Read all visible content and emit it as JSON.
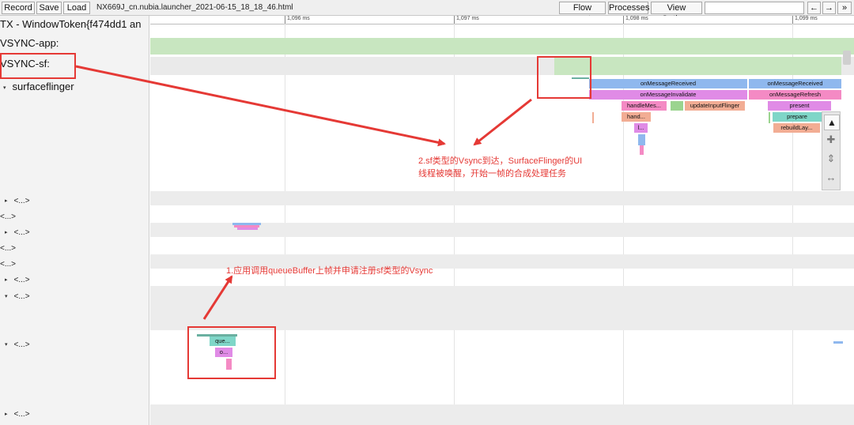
{
  "toolbar": {
    "record": "Record",
    "save": "Save",
    "load": "Load",
    "file_title": "NX669J_cn.nubia.launcher_2021-06-15_18_18_46.html",
    "flow_events": "Flow events",
    "processes": "Processes",
    "view_options": "View Options",
    "prev": "←",
    "next": "→",
    "more": "»"
  },
  "sidebar": {
    "tracks": [
      {
        "label": "TX - WindowToken{f474dd1 an"
      },
      {
        "label": "VSYNC-app:"
      },
      {
        "label": "VSYNC-sf:"
      },
      {
        "label": "surfaceflinger"
      }
    ],
    "collapsed": [
      {
        "label": "<...>",
        "arrow": "▸"
      },
      {
        "label": "<...>",
        "arrow": ""
      },
      {
        "label": "<...>",
        "arrow": "▸"
      },
      {
        "label": "<...>",
        "arrow": ""
      },
      {
        "label": "<...>",
        "arrow": ""
      },
      {
        "label": "<...>",
        "arrow": "▸"
      },
      {
        "label": "<...>",
        "arrow": "▾"
      },
      {
        "label": "<...>",
        "arrow": "▾"
      },
      {
        "label": "<...>",
        "arrow": "▸"
      }
    ]
  },
  "ruler": {
    "ticks": [
      "1,096 ms",
      "1,097 ms",
      "1,098 ms",
      "1,099 ms"
    ]
  },
  "slices": {
    "on_message_received_1": "onMessageReceived",
    "on_message_received_2": "onMessageReceived",
    "on_message_invalidate": "onMessageInvalidate",
    "on_message_refresh": "onMessageRefresh",
    "handle_mes": "handleMes...",
    "update_input_flinger": "updateInputFlinger",
    "present": "present",
    "hand": "hand...",
    "prepare": "prepare",
    "rebuild_lay": "rebuildLay...",
    "l_short": "l...",
    "que": "que...",
    "o_short": "o..."
  },
  "annotations": {
    "sf_note_line1": "2.sf类型的Vsync到达，SurfaceFlinger的UI",
    "sf_note_line2": "线程被唤醒，开始一帧的合成处理任务",
    "app_note": "1.应用调用queueBuffer上帧并申请注册sf类型的Vsync"
  },
  "colors": {
    "vsync_green": "#c8e6c0",
    "slice_blue": "#8fb8ee",
    "slice_violet": "#e08be6",
    "slice_pink": "#f48ac4",
    "slice_salmon": "#f2ad94",
    "slice_teal": "#7fd6c8",
    "annotation_red": "#e53935"
  }
}
